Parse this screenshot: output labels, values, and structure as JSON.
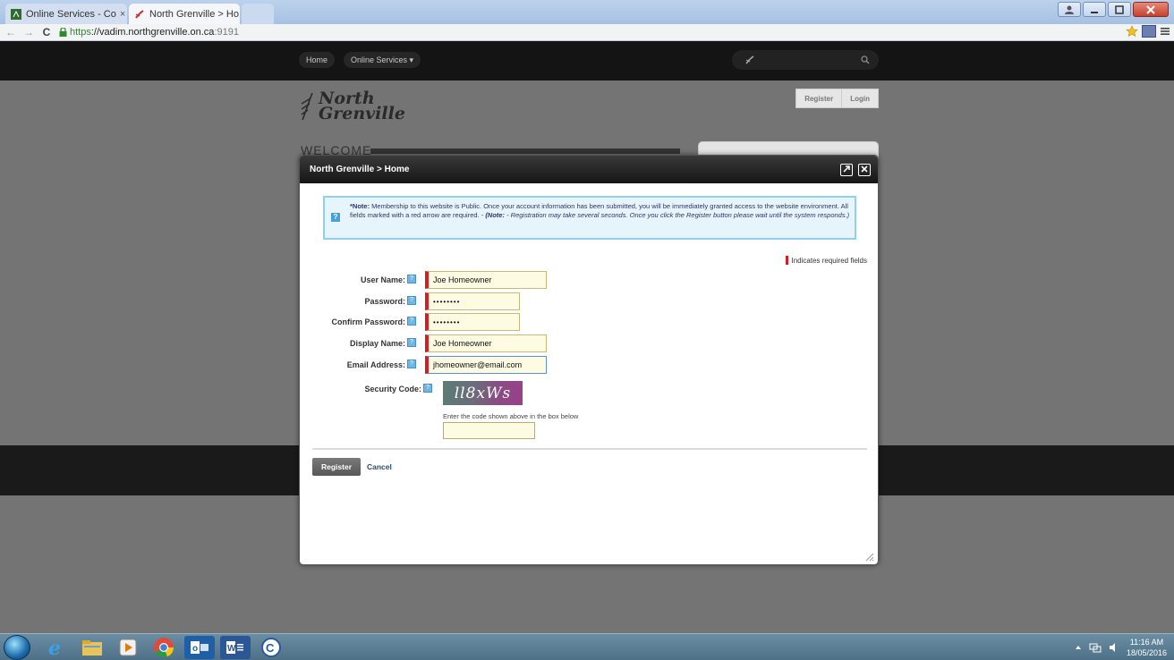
{
  "browser": {
    "tabs": [
      {
        "title": "Online Services - Co",
        "active": false
      },
      {
        "title": "North Grenville > Ho",
        "active": true
      }
    ],
    "url": {
      "scheme": "https",
      "host": "://vadim.northgrenville.on.ca",
      "port": ":9191"
    },
    "close_glyph": "×",
    "nav": {
      "back": "←",
      "forward": "→",
      "reload": "C"
    }
  },
  "site": {
    "nav": {
      "home": "Home",
      "online_services": "Online Services ▾"
    },
    "logo": {
      "line1": "North",
      "line2": "Grenville"
    },
    "auth": {
      "register": "Register",
      "login": "Login"
    },
    "welcome": "WELCOME"
  },
  "modal": {
    "title": "North Grenville > Home",
    "note": {
      "lead": "*Note:",
      "body": " Membership to this website is Public. Once your account information has been submitted, you will be immediately granted access to the website environment. All fields marked with a red arrow are required. - ",
      "note2_lead": "(Note:",
      "note2_body": " - Registration may take several seconds. Once you click the Register button please wait until the system responds.)"
    },
    "required_legend": "Indicates required fields",
    "fields": [
      {
        "label": "User Name:",
        "value": "Joe Homeowner"
      },
      {
        "label": "Password:",
        "value": "••••••••"
      },
      {
        "label": "Confirm Password:",
        "value": "••••••••"
      },
      {
        "label": "Display Name:",
        "value": "Joe Homeowner"
      },
      {
        "label": "Email Address:",
        "value": "jhomeowner@email.com"
      }
    ],
    "security": {
      "label": "Security Code:",
      "captcha": "ll8xWs",
      "hint": "Enter the code shown above in the box below"
    },
    "register_button": "Register",
    "cancel_link": "Cancel"
  },
  "taskbar": {
    "clock_time": "11:16 AM",
    "clock_date": "18/05/2016"
  },
  "colors": {
    "required": "#d21f1f",
    "note_border": "#8fd0ea",
    "field_bg": "#fdfbe2"
  }
}
